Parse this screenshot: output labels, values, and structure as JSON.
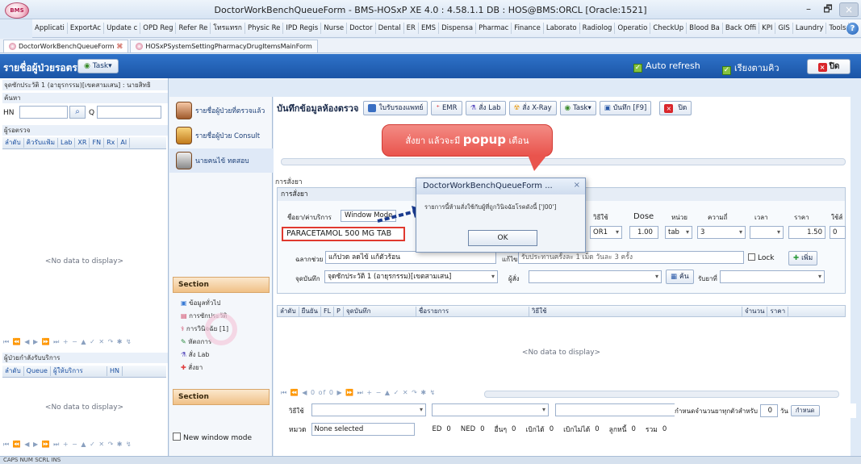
{
  "window": {
    "title": "DoctorWorkBenchQueueForm - BMS-HOSxP XE 4.0 : 4.58.1.1 DB : HOS@BMS:ORCL [Oracle:1521]",
    "logo_text": "BMS",
    "minimize": "–",
    "restore": "🗗",
    "close": "×"
  },
  "menubar": [
    "Applicati",
    "ExportAc",
    "Update c",
    "OPD Reg",
    "Refer Re",
    "โทรแทรก",
    "Physic Re",
    "IPD Regis",
    "Nurse",
    "Doctor",
    "Dental",
    "ER",
    "EMS",
    "Dispensa",
    "Pharmac",
    "Finance",
    "Laborato",
    "Radiolog",
    "Operatio",
    "CheckUp",
    "Blood Ba",
    "Back Offi",
    "KPI",
    "GIS",
    "Laundry",
    "Tools"
  ],
  "doc_tabs": [
    {
      "label": "DoctorWorkBenchQueueForm",
      "close": "⌘",
      "active": true
    },
    {
      "label": "HOSxPSystemSettingPharmacyDrugItemsMainForm",
      "active": false
    }
  ],
  "header": {
    "title": "รายชื่อผู้ป่วยรอตรวจ",
    "task_button": "Task▾",
    "auto_refresh": "Auto refresh",
    "sort_queue": "เรียงตามคิว",
    "close": "ปิด"
  },
  "left_panel": {
    "clinic_label": "จุดซักประวัติ 1 (อายุรกรรม)[เขตสามเสน] : นายสิทธิ",
    "search_label": "ค้นหา",
    "hn_label": "HN",
    "q_label": "Q",
    "waiting_label": "ผู้รอตรวจ",
    "waiting_columns": [
      "ลำดับ",
      "คิวรับแฟ้ม",
      "Lab",
      "XR",
      "FN",
      "Rx",
      "Al"
    ],
    "waiting_empty": "<No data to display>",
    "nav_symbols": "⏮ ⏪ ◀ ▶ ⏩ ⏭ + − ▲ ✓ ✕ ↷ ✱ ↯",
    "in_service_label": "ผู้ป่วยกำลังรับบริการ",
    "service_columns": [
      "ลำดับ",
      "Queue",
      "ผู้ให้บริการ",
      "HN"
    ],
    "service_empty": "<No data to display>"
  },
  "nav_column": {
    "items": [
      {
        "label": "รายชื่อผู้ป่วยที่ตรวจแล้ว"
      },
      {
        "label": "รายชื่อผู้ป่วย Consult"
      },
      {
        "label": "นายคนไข้ ทดสอบ"
      }
    ],
    "section_title": "Section",
    "section_items": [
      "ข้อมูลทั่วไป",
      "การซักประวัติ",
      "การวินิจฉัย [1]",
      "หัตถการ",
      "สั่ง Lab",
      "สั่งยา"
    ],
    "section_footer": "Section",
    "new_window_mode": "New window mode"
  },
  "toolbar": {
    "title": "บันทึกข้อมูลห้องตรวจ",
    "buttons": [
      "ใบรับรองแพทย์",
      "EMR",
      "สั่ง Lab",
      "สั่ง X-Ray",
      "Task▾",
      "บันทึก [F9]",
      "ปิด"
    ]
  },
  "callout": {
    "text_before": "สั่งยา แล้วจะมี",
    "text_bold": "popup",
    "text_after": "เตือน"
  },
  "dialog": {
    "title": "DoctorWorkBenchQueueForm ...",
    "close": "×",
    "message": "รายการนี้ห้ามสั่งใช้กับผู้ที่ถูกวินิจฉัยโรคดังนี้ ['J00']",
    "ok": "OK"
  },
  "order": {
    "group_label": "การสั่งยา",
    "sub_label": "การสั่งยา",
    "drug_field_label": "ชื่อยา/ค่าบริการ",
    "window_mode": "Window Mode",
    "drug_value": "PARACETAMOL 500 MG TAB",
    "usage_label": "วิธีใช้",
    "usage_value": "OR1",
    "dose_label": "Dose",
    "dose_value": "1.00",
    "unit_label": "หน่วย",
    "unit_value": "tab",
    "freq_label": "ความถี่",
    "freq_value": "3",
    "time_label": "เวลา",
    "price_label": "ราคา",
    "price_value": "1.50",
    "qty_label": "ใช้ส์",
    "qty_value": "0",
    "label_help": "ฉลากช่วย",
    "label_help_value": "แก้ปวด ลดไข้ แก้ตัวร้อน",
    "usage_text_label": "แก้ไข",
    "usage_text_value": "รับประทานครั้งละ 1 เม็ด วันละ 3 ครั้ง",
    "lock": "Lock",
    "add": "เพิ่ม",
    "record_point_label": "จุดบันทึก",
    "record_point_value": "จุดซักประวัติ 1 (อายุรกรรม)[เขตสามเสน]",
    "orderer_label": "ผู้สั่ง",
    "search_btn": "ค้น",
    "receiver_label": "รับยาที่"
  },
  "grid": {
    "columns": [
      "ลำดับ",
      "ยืนยัน",
      "FL",
      "P",
      "จุดบันทึก",
      "ชื่อรายการ",
      "วิธีใช้",
      "จำนวน",
      "ราคา"
    ],
    "empty": "<No data to display>",
    "pager": "0 of 0"
  },
  "bottom": {
    "usage_label": "วิธีใช้",
    "sum_days_label": "กำหนดจำนวนยาทุกตัวสำหรับ",
    "sum_days_value": "0",
    "day_unit": "วัน",
    "apply_btn": "กำหนด",
    "category_label": "หมวด",
    "category_value": "None selected",
    "ed_label": "ED",
    "ed_value": "0",
    "ned_label": "NED",
    "ned_value": "0",
    "other_label": "อื่นๆ",
    "other_value": "0",
    "claim_label": "เบิกได้",
    "claim_value": "0",
    "noclaim_label": "เบิกไม่ได้",
    "noclaim_value": "0",
    "debtor_label": "ลูกหนี้",
    "debtor_value": "0",
    "total_label": "รวม",
    "total_value": "0"
  },
  "status": "CAPS  NUM  SCRL  INS"
}
